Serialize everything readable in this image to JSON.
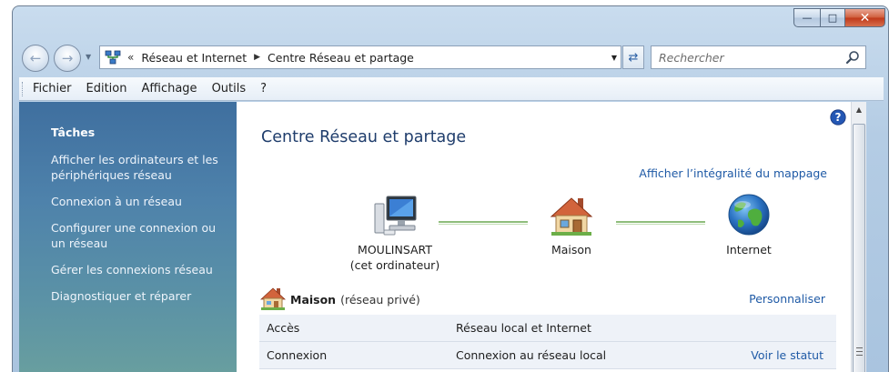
{
  "window": {
    "controls": {
      "minimize": "—",
      "maximize": "□",
      "close": "✕"
    }
  },
  "nav": {
    "back_icon": "arrow-left-icon",
    "forward_icon": "arrow-right-icon",
    "address": {
      "icon": "network-icon",
      "crumbs": [
        "Réseau et Internet",
        "Centre Réseau et partage"
      ]
    },
    "search": {
      "placeholder": "Rechercher"
    }
  },
  "menubar": {
    "items": [
      "Fichier",
      "Edition",
      "Affichage",
      "Outils",
      "?"
    ]
  },
  "sidebar": {
    "title": "Tâches",
    "links": [
      "Afficher les ordinateurs et les périphériques réseau",
      "Connexion à un réseau",
      "Configurer une connexion ou un réseau",
      "Gérer les connexions réseau",
      "Diagnostiquer et réparer"
    ]
  },
  "main": {
    "title": "Centre Réseau et partage",
    "map_link": "Afficher l’intégralité du mappage",
    "nodes": [
      {
        "line1": "MOULINSART",
        "line2": "(cet ordinateur)",
        "icon": "computer-icon"
      },
      {
        "line1": "Maison",
        "icon": "house-icon"
      },
      {
        "line1": "Internet",
        "icon": "globe-icon"
      }
    ],
    "network": {
      "name": "Maison",
      "type": "(réseau privé)",
      "customize": "Personnaliser",
      "rows": [
        {
          "key": "Accès",
          "value": "Réseau local et Internet",
          "action": ""
        },
        {
          "key": "Connexion",
          "value": "Connexion au réseau local",
          "action": "Voir le statut"
        }
      ]
    }
  },
  "colors": {
    "sidebar_top": "#3f6f9f",
    "sidebar_bottom": "#6aa09e",
    "link": "#1f5aa6",
    "title": "#1f3d6c",
    "connection_line": "#8fbd7c"
  }
}
